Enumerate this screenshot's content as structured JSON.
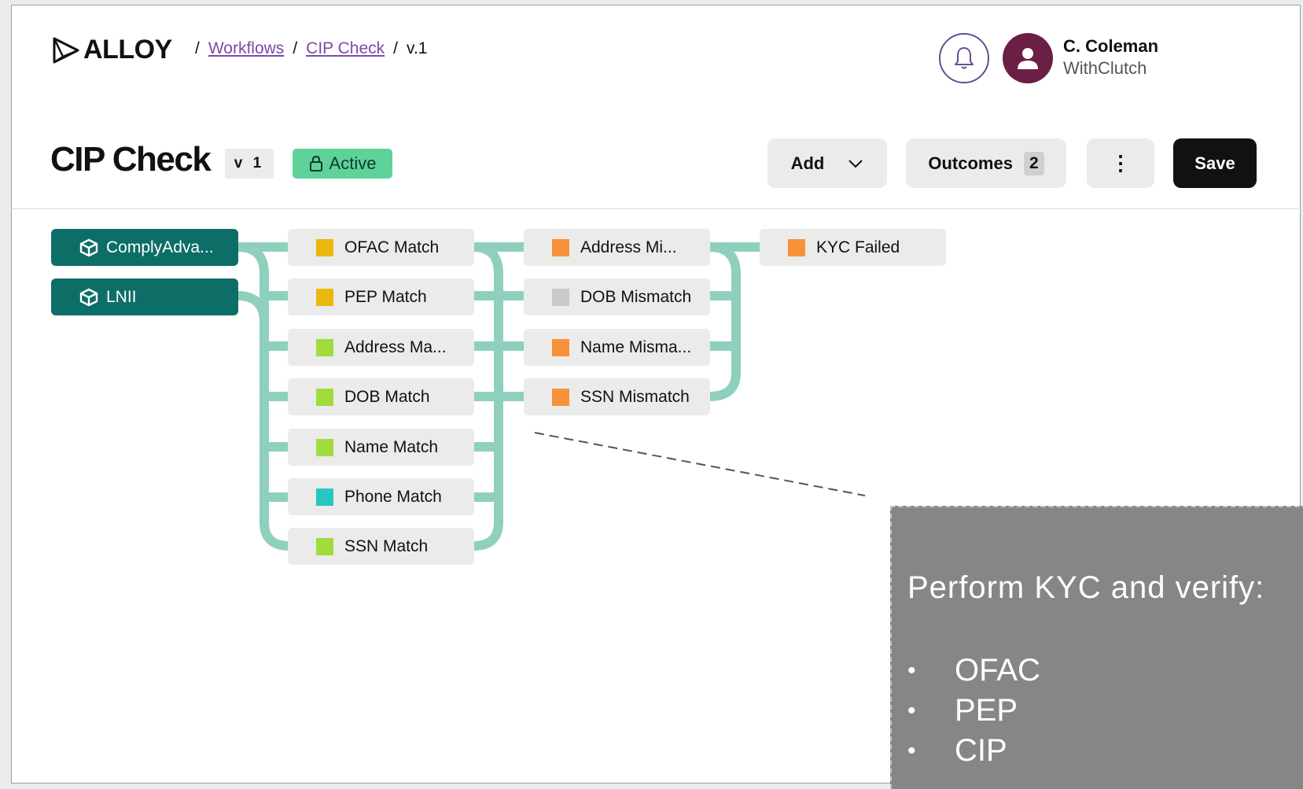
{
  "brand": {
    "name": "ALLOY"
  },
  "breadcrumb": {
    "sep": "/",
    "items": [
      "Workflows",
      "CIP Check"
    ],
    "current": "v.1"
  },
  "user": {
    "name": "C. Coleman",
    "org": "WithClutch"
  },
  "page": {
    "title": "CIP Check",
    "version": "v 1",
    "status": "Active"
  },
  "toolbar": {
    "add_label": "Add",
    "outcomes_label": "Outcomes",
    "outcomes_count": "2",
    "more_label": "⋮",
    "save_label": "Save"
  },
  "sources": [
    "ComplyAdva...",
    "LNII"
  ],
  "matches": [
    {
      "label": "OFAC Match",
      "color": "#e8b80e"
    },
    {
      "label": "PEP Match",
      "color": "#e8b80e"
    },
    {
      "label": "Address Ma...",
      "color": "#9fdc3c"
    },
    {
      "label": "DOB Match",
      "color": "#9fdc3c"
    },
    {
      "label": "Name Match",
      "color": "#9fdc3c"
    },
    {
      "label": "Phone Match",
      "color": "#27c7c0"
    },
    {
      "label": "SSN Match",
      "color": "#9fdc3c"
    }
  ],
  "mismatches": [
    {
      "label": "Address Mi...",
      "color": "#f7923a"
    },
    {
      "label": "DOB Mismatch",
      "color": "#c9c9c9"
    },
    {
      "label": "Name Misma...",
      "color": "#f7923a"
    },
    {
      "label": "SSN Mismatch",
      "color": "#f7923a"
    }
  ],
  "outcomes": [
    {
      "label": "KYC Failed",
      "color": "#f7923a"
    }
  ],
  "callout": {
    "heading": "Perform KYC and verify:",
    "items": [
      "OFAC",
      "PEP",
      "CIP"
    ]
  },
  "colors": {
    "connector": "#8ed0bd",
    "source_bg": "#0c6e67",
    "active_badge": "#5fd29a",
    "avatar": "#6b1f45"
  }
}
